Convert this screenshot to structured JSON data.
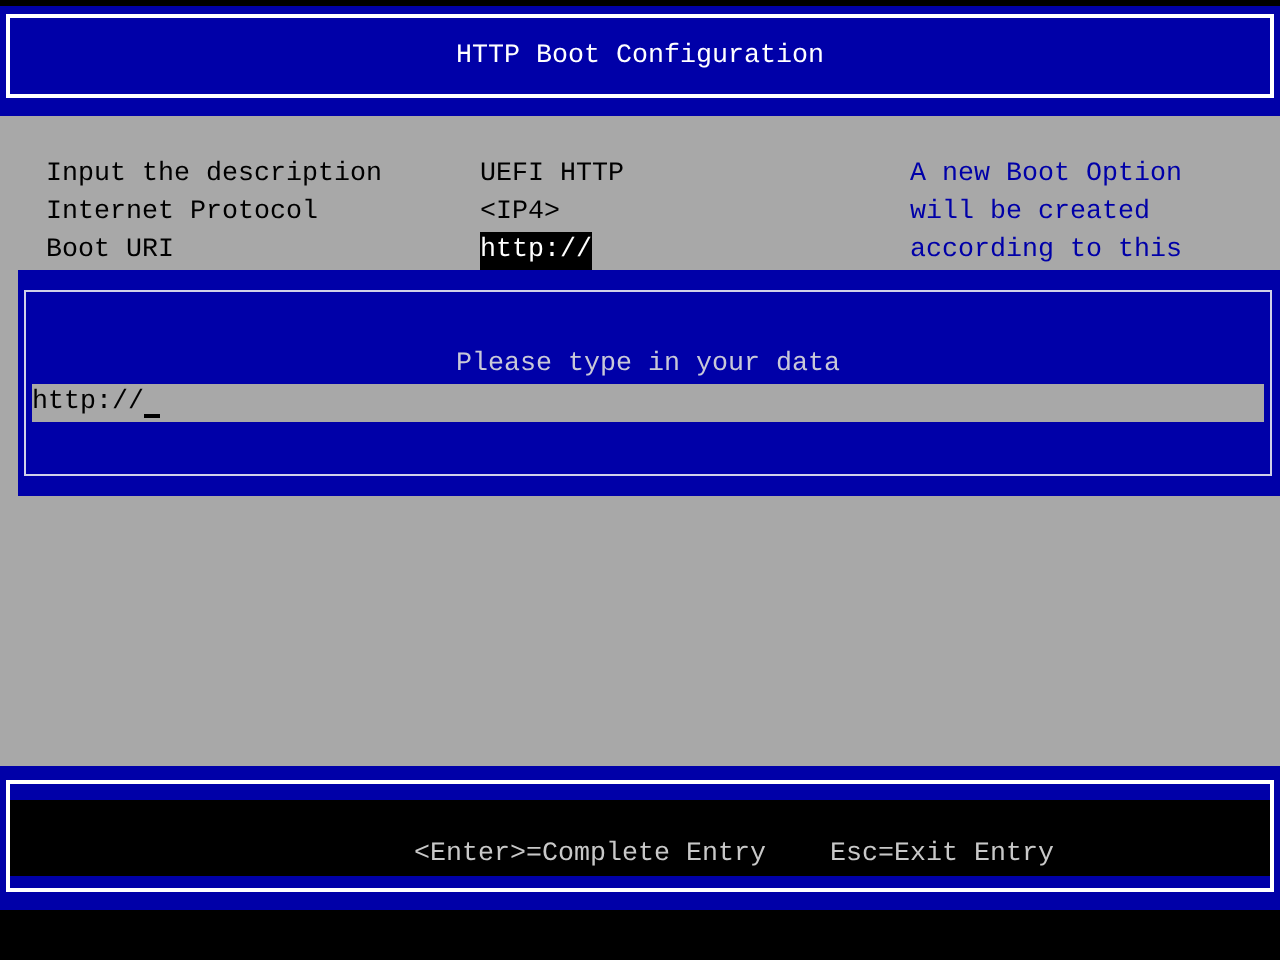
{
  "header": {
    "title": "HTTP Boot Configuration"
  },
  "fields": [
    {
      "label": "Input the description",
      "value": "UEFI HTTP",
      "selected": false
    },
    {
      "label": "Internet Protocol",
      "value": "<IP4>",
      "selected": false
    },
    {
      "label": "Boot URI",
      "value": "http://",
      "selected": true
    }
  ],
  "help_lines": [
    "A new Boot Option",
    "will be created",
    "according to this"
  ],
  "dialog": {
    "prompt": "Please type in your data",
    "value": "http://"
  },
  "footer": {
    "hints": [
      "<Enter>=Complete Entry",
      "Esc=Exit Entry"
    ]
  }
}
